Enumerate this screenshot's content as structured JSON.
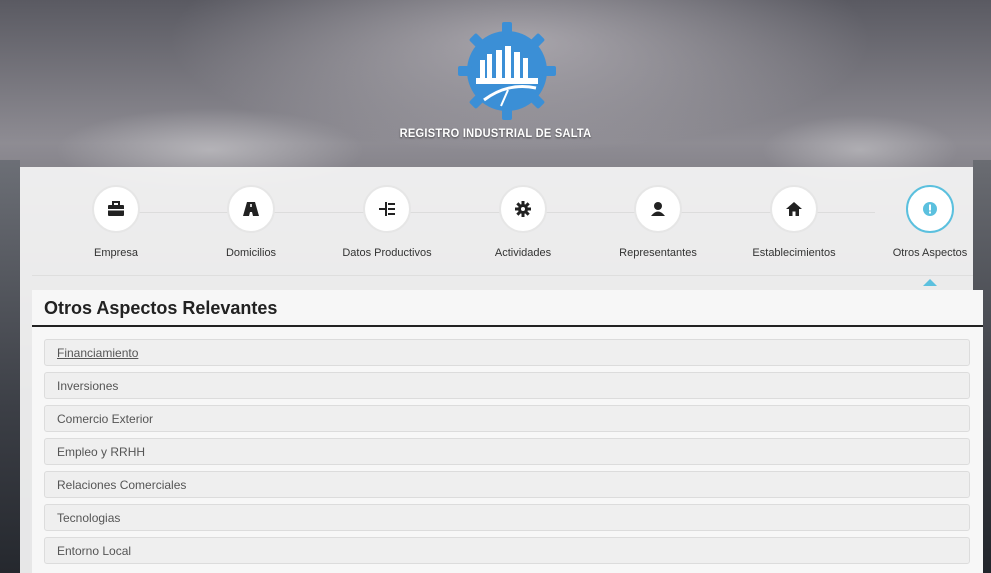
{
  "brand": {
    "title": "REGISTRO INDUSTRIAL DE SALTA",
    "logo_icon": "factory-gear-logo",
    "logo_color": "#3b8fd6"
  },
  "wizard": {
    "steps": [
      {
        "label": "Empresa",
        "icon": "briefcase-icon",
        "glyph": "💼"
      },
      {
        "label": "Domicilios",
        "icon": "road-icon",
        "glyph": "▲"
      },
      {
        "label": "Datos Productivos",
        "icon": "sitemap-icon",
        "glyph": "⊣"
      },
      {
        "label": "Actividades",
        "icon": "gear-icon",
        "glyph": "✱"
      },
      {
        "label": "Representantes",
        "icon": "user-icon",
        "glyph": "●"
      },
      {
        "label": "Establecimientos",
        "icon": "home-icon",
        "glyph": "⌂"
      },
      {
        "label": "Otros Aspectos",
        "icon": "exclamation-circle-icon",
        "glyph": "!"
      }
    ],
    "active_index": 6,
    "active_color": "#5bc0de"
  },
  "section": {
    "title": "Otros Aspectos Relevantes",
    "items": [
      "Financiamiento",
      "Inversiones",
      "Comercio Exterior",
      "Empleo y RRHH",
      "Relaciones Comerciales",
      "Tecnologias",
      "Entorno Local"
    ]
  }
}
